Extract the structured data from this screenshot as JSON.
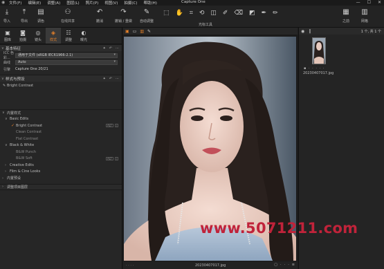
{
  "menu": {
    "items": [
      "文件(F)",
      "编辑(E)",
      "调整(A)",
      "图层(L)",
      "照片(P)",
      "视图(V)",
      "拍摄(C)",
      "帮助(H)"
    ],
    "window_title": "Capture One",
    "controls": [
      "—",
      "☐",
      "✕"
    ]
  },
  "toolbar": {
    "import_label": "导入",
    "export_label": "导出",
    "manage_label": "调色",
    "share_label": "在线共享",
    "undo_label": "撤消",
    "redo_label": "撤销 / 重做",
    "auto_label": "自动调整",
    "cursor_tools_label": "光标工具",
    "workspace_label": "之前",
    "grid_label": "网格"
  },
  "left_tabs": [
    {
      "label": "图库",
      "icon": "library-icon"
    },
    {
      "label": "拍摄",
      "icon": "camera-icon"
    },
    {
      "label": "镜头",
      "icon": "lens-icon"
    },
    {
      "label": "样式",
      "icon": "styles-icon"
    },
    {
      "label": "调整",
      "icon": "adjust-icon"
    },
    {
      "label": "曝光",
      "icon": "exposure-icon"
    }
  ],
  "basic_characteristics": {
    "title": "基本特征",
    "icc_label": "ICC 色彩...",
    "icc_value": "通用于文件 (sRGB IEC61966-2.1)",
    "curve_label": "曲线",
    "curve_value": "Auto",
    "engine_label": "引擎",
    "engine_value": "Capture One 20/21"
  },
  "styles_presets": {
    "title": "样式与预设",
    "applied": "Bright Contrast",
    "builtin_title": "内置样式",
    "groups": [
      {
        "name": "Basic Edits",
        "items": [
          {
            "label": "Bright Contrast",
            "active": true,
            "badge": "ALT"
          },
          {
            "label": "Clean Contrast",
            "active": false
          },
          {
            "label": "Flat Contrast",
            "active": false
          }
        ]
      },
      {
        "name": "Black & White",
        "items": [
          {
            "label": "B&W Punch",
            "active": false
          },
          {
            "label": "B&W Soft",
            "active": false,
            "badge": "ALT"
          }
        ]
      }
    ],
    "collapsed_groups": [
      "Creative Edits",
      "Film & Cine Looks"
    ],
    "builtin_presets_title": "内置预设",
    "layer_title": "调整项目图层"
  },
  "viewer": {
    "file_name": "20230407017.jpg"
  },
  "browser": {
    "count": "1 个, 共 1 个",
    "thumb_dots": "▪ · · · · ·",
    "thumb_name": "20230407017.jpg"
  },
  "watermark": "www.5071211.com",
  "colors": {
    "accent": "#e8822a",
    "watermark": "#c0233a",
    "panel": "#262626"
  }
}
